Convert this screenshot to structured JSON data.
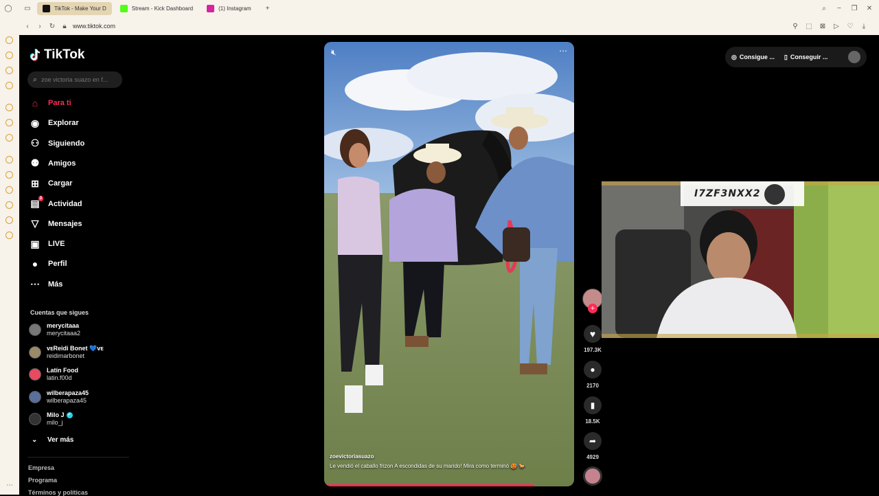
{
  "browser": {
    "tabs": [
      {
        "label": "TikTok - Make Your D",
        "color": "#111111",
        "active": true
      },
      {
        "label": "Stream - Kick Dashboard",
        "color": "#53fc18",
        "active": false
      },
      {
        "label": "(1) Instagram",
        "color": "#d6249f",
        "active": false
      }
    ],
    "new_tab": "+",
    "url": "www.tiktok.com"
  },
  "tiktok": {
    "logo_text": "TikTok",
    "search_placeholder": "zoe victoria suazo en f...",
    "nav": [
      {
        "label": "Para ti",
        "icon": "home-icon",
        "active": true
      },
      {
        "label": "Explorar",
        "icon": "compass-icon"
      },
      {
        "label": "Siguiendo",
        "icon": "following-icon"
      },
      {
        "label": "Amigos",
        "icon": "friends-icon"
      },
      {
        "label": "Cargar",
        "icon": "upload-icon"
      },
      {
        "label": "Actividad",
        "icon": "activity-icon",
        "badge": "3"
      },
      {
        "label": "Mensajes",
        "icon": "messages-icon"
      },
      {
        "label": "LIVE",
        "icon": "live-icon"
      },
      {
        "label": "Perfil",
        "icon": "profile-icon"
      },
      {
        "label": "Más",
        "icon": "more-icon"
      }
    ],
    "following_title": "Cuentas que sigues",
    "accounts": [
      {
        "name": "merycitaaa",
        "handle": "merycitaaa2"
      },
      {
        "name": "ᴠᴇReidi Bonet 💙ᴠᴇ",
        "handle": "reidimarbonet"
      },
      {
        "name": "Latín Food",
        "handle": "latin.f00d"
      },
      {
        "name": "wilberapaza45",
        "handle": "wilberapaza45"
      },
      {
        "name": "Milo J",
        "handle": "milo_j",
        "verified": true
      }
    ],
    "see_more": "Ver más",
    "footer": [
      "Empresa",
      "Programa",
      "Términos y políticas"
    ]
  },
  "video": {
    "author": "zoevictoriasuazo",
    "caption": "Le vendió el caballo frizon A escondidas de su marido! Mira como terminó 🥵 🐎",
    "progress": 0.84
  },
  "actions": {
    "likes": "197.3K",
    "comments": "2170",
    "saves": "18.5K",
    "shares": "4929"
  },
  "topbar": {
    "btn1": "Consigue ...",
    "btn2": "Conseguir ..."
  },
  "webcam": {
    "overlay_name": "I7ZF3NXX2"
  }
}
